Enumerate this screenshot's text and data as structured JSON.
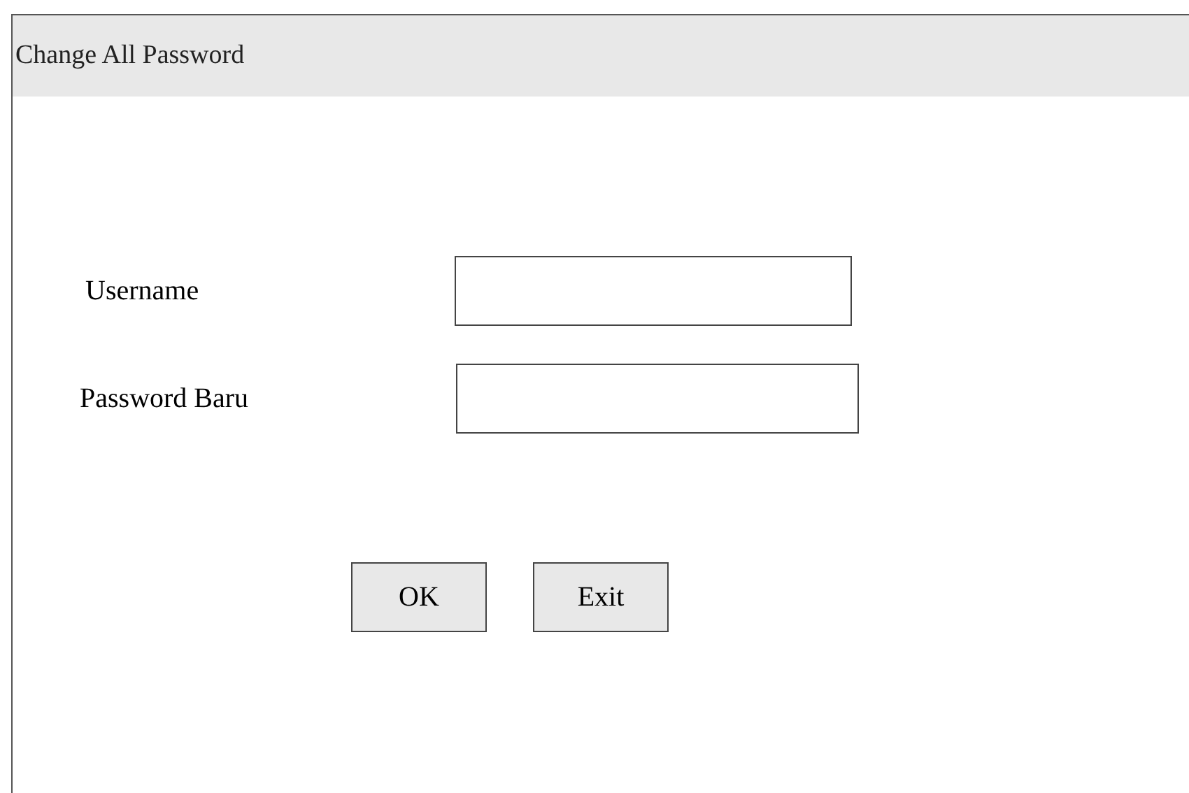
{
  "window": {
    "title": "Change All Password"
  },
  "fields": [
    {
      "label": "Username"
    },
    {
      "label": "Password Baru"
    }
  ],
  "buttons": [
    "OK",
    "Exit"
  ]
}
